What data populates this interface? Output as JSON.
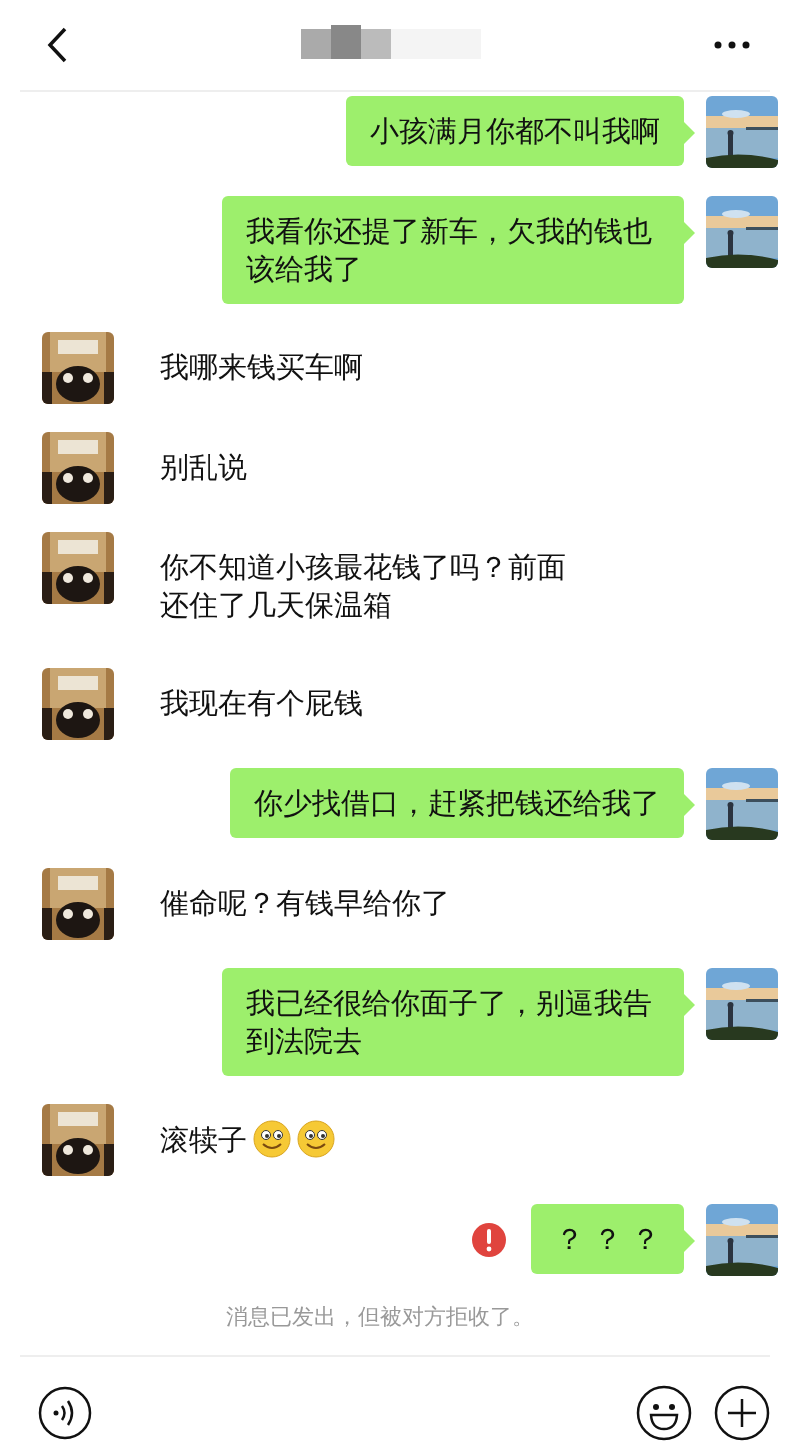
{
  "header": {
    "title_blurred": true
  },
  "messages": [
    {
      "outgoing": true,
      "text": "小孩满月你都不叫我啊",
      "failed": false
    },
    {
      "outgoing": true,
      "text": "我看你还提了新车，欠我的钱也该给我了",
      "failed": false
    },
    {
      "outgoing": false,
      "text": "我哪来钱买车啊",
      "failed": false
    },
    {
      "outgoing": false,
      "text": "别乱说",
      "failed": false
    },
    {
      "outgoing": false,
      "text": "你不知道小孩最花钱了吗？前面还住了几天保温箱",
      "failed": false
    },
    {
      "outgoing": false,
      "text": "我现在有个屁钱",
      "failed": false
    },
    {
      "outgoing": true,
      "text": "你少找借口，赶紧把钱还给我了",
      "failed": false
    },
    {
      "outgoing": false,
      "text": "催命呢？有钱早给你了",
      "failed": false
    },
    {
      "outgoing": true,
      "text": "我已经很给你面子了，别逼我告到法院去",
      "failed": false
    },
    {
      "outgoing": false,
      "text": "滚犊子",
      "failed": false,
      "icons": [
        {
          "kind": "smiley"
        },
        {
          "kind": "smiley"
        }
      ]
    },
    {
      "outgoing": true,
      "text": "？ ？ ？",
      "failed": true
    }
  ],
  "notice": "消息已发出，但被对方拒收了。"
}
